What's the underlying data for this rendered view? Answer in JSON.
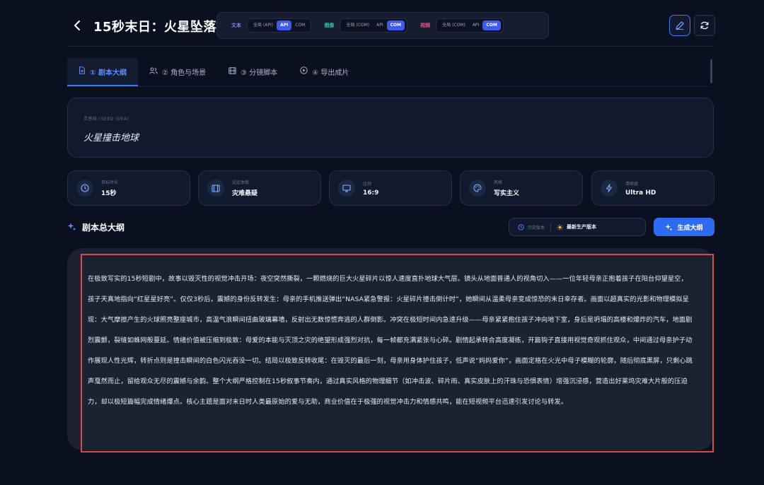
{
  "header": {
    "back_icon": "chevron-left-icon",
    "title": "15秒末日：火星坠落",
    "modes": [
      {
        "label": "文本",
        "color": "#8b7cf6",
        "options": [
          "全局 (API)",
          "API",
          "COM"
        ],
        "selected": "API"
      },
      {
        "label": "图像",
        "color": "#2ec4a8",
        "options": [
          "全局 (COM)",
          "API",
          "COM"
        ],
        "selected": "COM"
      },
      {
        "label": "视频",
        "color": "#e6568a",
        "options": [
          "全局 (COM)",
          "API",
          "COM"
        ],
        "selected": "COM"
      }
    ],
    "edit_icon": "pencil-icon",
    "refresh_icon": "refresh-icon"
  },
  "tabs": [
    {
      "label": "① 剧本大纲",
      "icon": "document-icon",
      "active": true
    },
    {
      "label": "② 角色与场景",
      "icon": "users-icon",
      "active": false
    },
    {
      "label": "③ 分镜脚本",
      "icon": "film-icon",
      "active": false
    },
    {
      "label": "④ 导出成片",
      "icon": "play-icon",
      "active": false
    }
  ],
  "seed": {
    "label": "灵感核 (SEED IDEA)",
    "value": "火星撞击地球"
  },
  "params": [
    {
      "label": "目标时长",
      "value": "15秒",
      "icon": "clock-icon"
    },
    {
      "label": "设定体裁",
      "value": "灾难悬疑",
      "icon": "film-icon"
    },
    {
      "label": "比例",
      "value": "16:9",
      "icon": "monitor-icon"
    },
    {
      "label": "风格",
      "value": "写实主义",
      "icon": "palette-icon"
    },
    {
      "label": "清晰度",
      "value": "Ultra HD",
      "icon": "bolt-icon"
    }
  ],
  "outline": {
    "title": "剧本总大纲",
    "title_icon": "sparkles-icon",
    "history_label": "历史版本",
    "latest_label": "最新生产版本",
    "generate_label": "生成大纲",
    "text": "在极致写实的15秒短剧中，故事以毁灭性的视觉冲击开场：夜空突然撕裂，一颗燃烧的巨大火星碎片以惊人速度直扑地球大气层。镜头从地面普通人的视角切入——一位年轻母亲正抱着孩子在阳台仰望星空，孩子天真地指向“红星星好亮”。仅仅3秒后，震撼的身份反转发生：母亲的手机推送弹出“NASA紧急警报：火星碎片撞击倒计时”，她瞬间从温柔母亲变成惊恐的末日幸存者。画面以超真实的光影和物理模拟呈现：大气摩擦产生的火球照亮整座城市，高温气浪瞬间扭曲玻璃幕墙，反射出无数惊慌奔逃的人群倒影。冲突在极短时间内急速升级——母亲紧紧抱住孩子冲向地下室，身后是坍塌的高楼和爆炸的汽车，地面剧烈震颤，裂缝如蛛网般蔓延。情绪价值被压缩到极致：母爱的本能与灭顶之灾的绝望形成强烈对抗，每一帧都充满紧张与心碎。剧情起承转合高度凝练，开篇钩子直接用视觉奇观抓住观众，中间通过母亲护子动作展现人性光辉，转折点则是撞击瞬间的白色闪光吞没一切。结局以极致反转收尾：在毁灭的最后一刻，母亲用身体护住孩子，低声说“妈妈爱你”，画面定格在火光中母子模糊的轮廓，随后彻底黑屏，只剩心跳声戛然而止，留给观众无尽的震撼与余韵。整个大纲严格控制在15秒叙事节奏内，通过真实风格的物理细节（如冲击波、碎片雨、真实皮肤上的汗珠与恐惧表情）增强沉浸感，营造出好莱坞灾难大片般的压迫力，却以极短篇幅完成情绪爆点。核心主题是面对末日时人类最原始的爱与无助，商业价值在于极强的视觉冲击力和情感共鸣，能在短视频平台迅速引发讨论与转发。"
  }
}
